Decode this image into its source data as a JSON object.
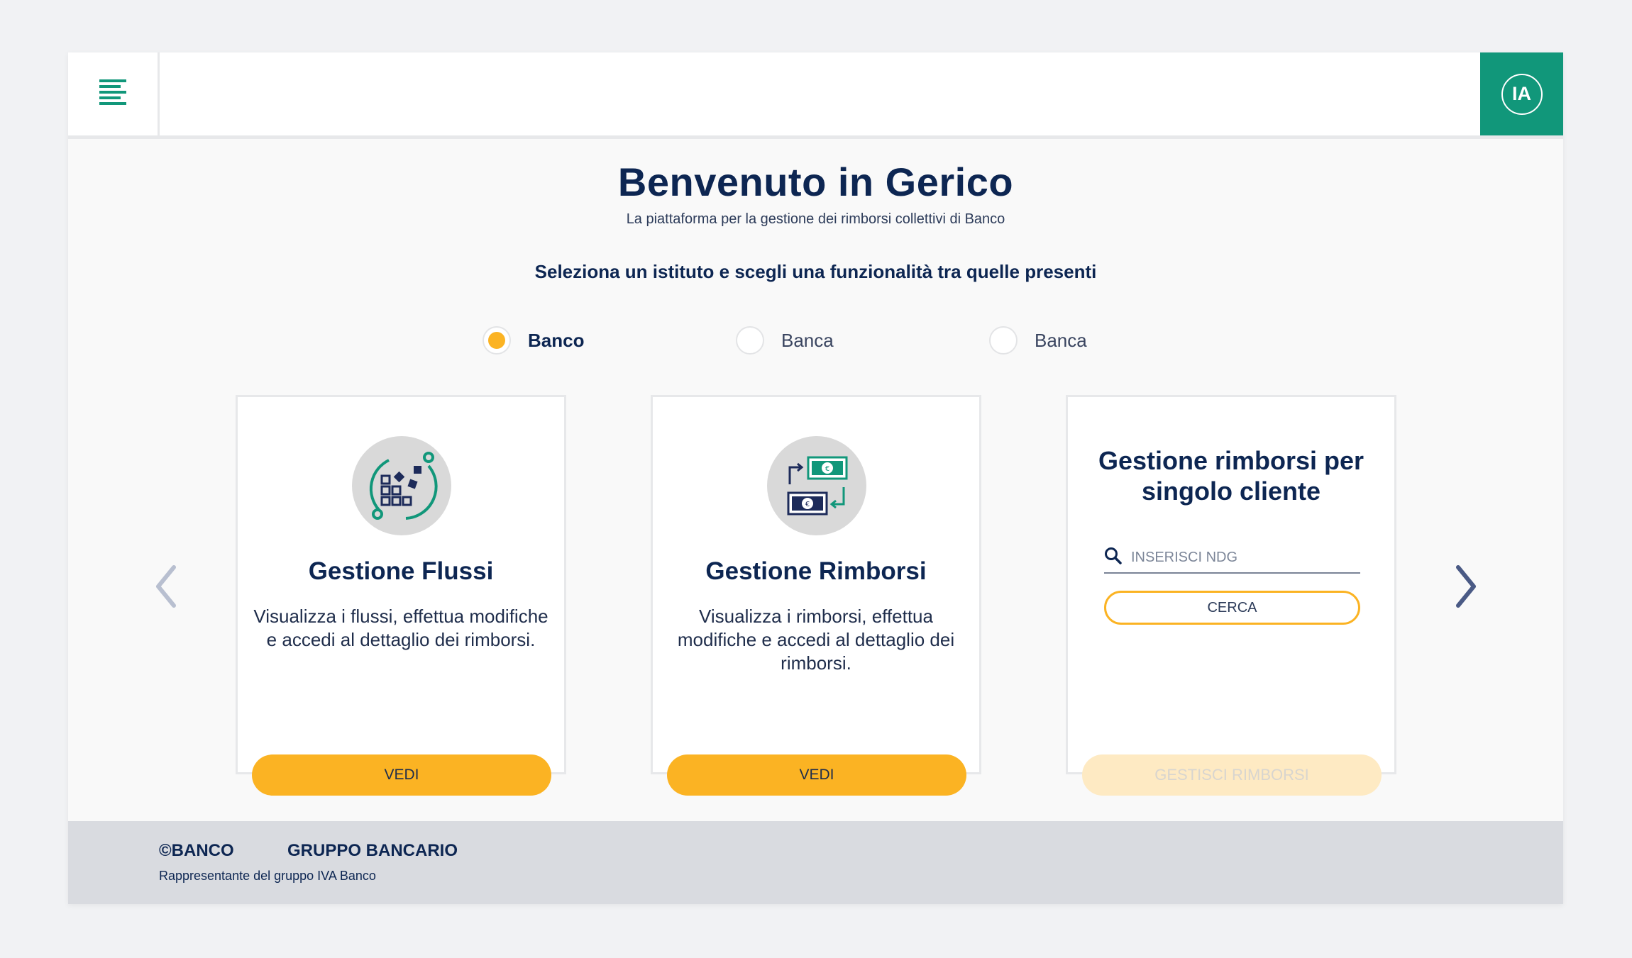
{
  "header": {
    "avatar_initials": "IA",
    "accent_color": "#11977a"
  },
  "main": {
    "title": "Benvenuto in Gerico",
    "subtitle": "La piattaforma per la gestione dei rimborsi collettivi di Banco",
    "instruction": "Seleziona un istituto e scegli una funzionalità tra quelle presenti",
    "radios": [
      {
        "label": "Banco",
        "checked": true
      },
      {
        "label": "Banca",
        "checked": false
      },
      {
        "label": "Banca",
        "checked": false
      }
    ],
    "cards": [
      {
        "title": "Gestione Flussi",
        "description": "Visualizza i flussi, effettua modifiche e  accedi al dettaglio dei rimborsi.",
        "button": "VEDI",
        "icon": "workflow-blocks-icon"
      },
      {
        "title": "Gestione Rimborsi",
        "description": "Visualizza i rimborsi, effettua modifiche e accedi al dettaglio dei rimborsi.",
        "button": "VEDI",
        "icon": "money-exchange-icon"
      },
      {
        "title": "Gestione rimborsi per singolo cliente",
        "search_placeholder": "INSERISCI NDG",
        "search_button": "CERCA",
        "action_button": "GESTISCI RIMBORSI",
        "action_enabled": false
      }
    ]
  },
  "footer": {
    "brand": "©BANCO",
    "group": "GRUPPO BANCARIO",
    "note": "Rappresentante del gruppo IVA Banco"
  },
  "colors": {
    "primary_button": "#fbb323",
    "title_navy": "#0d2652",
    "teal": "#11977a"
  }
}
